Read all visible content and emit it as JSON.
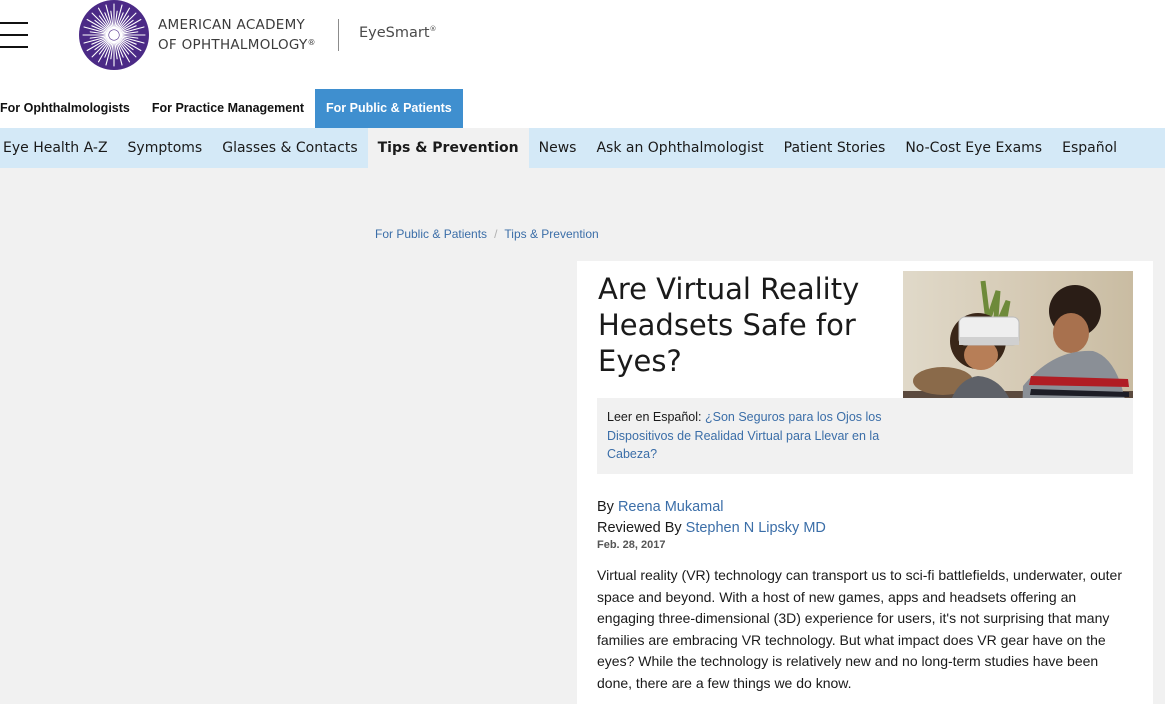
{
  "header": {
    "org_line1": "AMERICAN ACADEMY",
    "org_line2": "OF OPHTHALMOLOGY",
    "org_mark": "®",
    "site": "EyeSmart",
    "site_mark": "®"
  },
  "audience_nav": [
    {
      "label": "For Ophthalmologists",
      "active": false
    },
    {
      "label": "For Practice Management",
      "active": false
    },
    {
      "label": "For Public & Patients",
      "active": true
    }
  ],
  "main_nav": [
    {
      "label": "Eye Health A-Z",
      "active": false
    },
    {
      "label": "Symptoms",
      "active": false
    },
    {
      "label": "Glasses & Contacts",
      "active": false
    },
    {
      "label": "Tips & Prevention",
      "active": true
    },
    {
      "label": "News",
      "active": false
    },
    {
      "label": "Ask an Ophthalmologist",
      "active": false
    },
    {
      "label": "Patient Stories",
      "active": false
    },
    {
      "label": "No-Cost Eye Exams",
      "active": false
    },
    {
      "label": "Español",
      "active": false
    }
  ],
  "breadcrumb": [
    "For Public & Patients",
    "Tips & Prevention"
  ],
  "article": {
    "title": "Are Virtual Reality Headsets Safe for Eyes?",
    "spanish_label": "Leer en Español: ",
    "spanish_link": "¿Son Seguros para los Ojos los Dispositivos de Realidad Virtual para Llevar en la Cabeza?",
    "by_label": "By ",
    "author": "Reena Mukamal",
    "reviewed_label": "Reviewed By ",
    "reviewer": "Stephen N Lipsky MD",
    "date": "Feb. 28, 2017",
    "body": "Virtual reality (VR) technology can transport us to sci-fi battlefields, underwater, outer space and beyond. With a host of new games, apps and headsets offering an engaging three-dimensional (3D) experience for users, it's not surprising that many families are embracing VR technology. But what impact does VR gear have on the eyes? While the technology is relatively new and no long-term studies have been done, there are a few things we do know."
  },
  "colors": {
    "accent_blue": "#3f8fcf",
    "nav_bg": "#d4e9f7",
    "link": "#3b6ea8",
    "logo_purple": "#4b2a86"
  },
  "icons": {
    "menu": "hamburger-menu-icon",
    "logo": "aao-starburst-logo"
  }
}
